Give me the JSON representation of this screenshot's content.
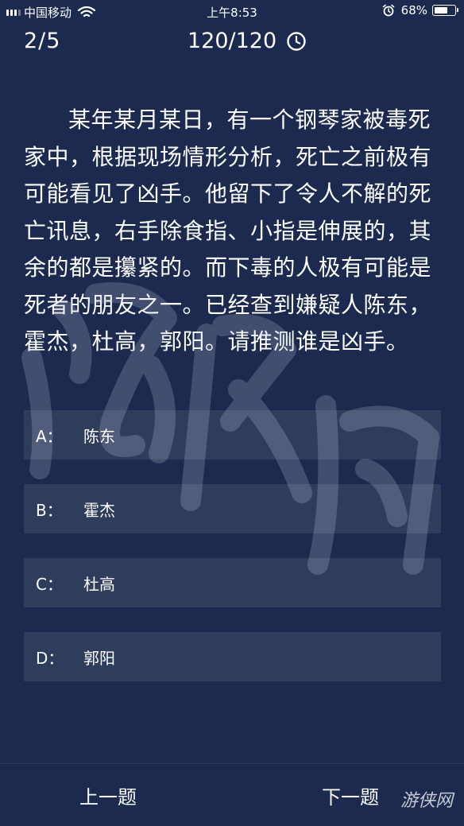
{
  "status_bar": {
    "carrier": "中国移动",
    "time": "上午8:53",
    "battery_percent": "68%",
    "battery_level": 0.68
  },
  "header": {
    "progress": "2/5",
    "timer": "120/120"
  },
  "question": {
    "text": "某年某月某日，有一个钢琴家被毒死家中，根据现场情形分析，死亡之前极有可能看见了凶手。他留下了令人不解的死亡讯息，右手除食指、小指是伸展的，其余的都是攥紧的。而下毒的人极有可能是死者的朋友之一。已经查到嫌疑人陈东，霍杰，杜高，郭阳。请推测谁是凶手。"
  },
  "options": [
    {
      "letter": "A：",
      "text": "陈东"
    },
    {
      "letter": "B：",
      "text": "霍杰"
    },
    {
      "letter": "C：",
      "text": "杜高"
    },
    {
      "letter": "D：",
      "text": "郭阳"
    }
  ],
  "footer": {
    "prev_label": "上一题",
    "next_label": "下一题",
    "brand": "游侠网"
  },
  "colors": {
    "background": "#1b2a4e",
    "option_background": "rgba(255,255,255,0.09)",
    "text": "#ffffff"
  },
  "icons": [
    "signal-icon",
    "wifi-icon",
    "alarm-icon",
    "battery-icon",
    "clock-icon"
  ]
}
